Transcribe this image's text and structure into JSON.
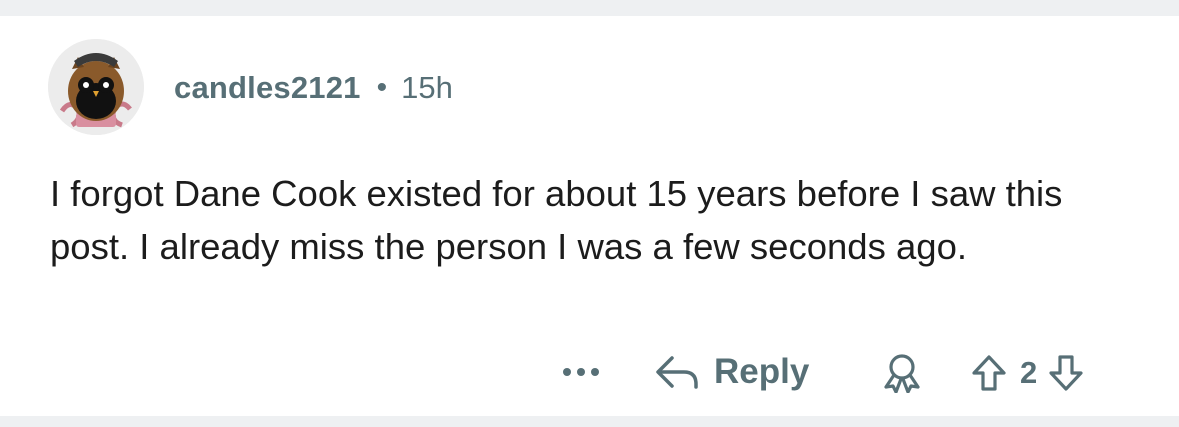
{
  "comment": {
    "author": "candles2121",
    "separator": "•",
    "time_ago": "15h",
    "text": "I forgot Dane Cook existed for about 15 years before I saw this post. I already miss the person I was a few seconds ago."
  },
  "actions": {
    "more_icon": "more-horizontal-icon",
    "reply_icon": "reply-arrow-icon",
    "reply_label": "Reply",
    "award_icon": "award-icon",
    "upvote_icon": "upvote-arrow-icon",
    "score": "2",
    "downvote_icon": "downvote-arrow-icon"
  },
  "colors": {
    "background": "#eef0f2",
    "card": "#ffffff",
    "meta_text": "#576f76",
    "body_text": "#1c1c1c"
  }
}
